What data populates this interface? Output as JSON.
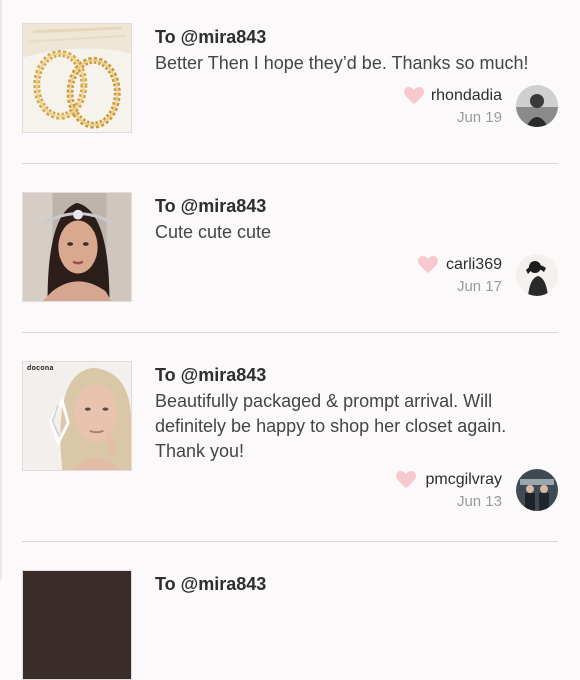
{
  "reviews": [
    {
      "to": "To @mira843",
      "comment": "Better Then I hope they’d be. Thanks so much!",
      "username": "rhondadia",
      "date": "Jun 19",
      "thumb_icon": "gold-hoop-earrings-photo",
      "avatar_icon": "user-avatar-photo"
    },
    {
      "to": "To @mira843",
      "comment": "Cute cute cute",
      "username": "carli369",
      "date": "Jun 17",
      "thumb_icon": "head-jewelry-model-photo",
      "avatar_icon": "user-avatar-photo"
    },
    {
      "to": "To @mira843",
      "comment": "Beautifully packaged & prompt arrival. Will definitely be happy to shop her closet again. Thank you!",
      "username": "pmcgilvray",
      "date": "Jun 13",
      "thumb_icon": "earring-model-photo",
      "thumb_brand": "docona",
      "avatar_icon": "user-avatar-photo"
    },
    {
      "to": "To @mira843"
    }
  ],
  "colors": {
    "heart": "#f7c9cf",
    "divider": "#dcd7d7",
    "date": "#9b9b9b"
  }
}
